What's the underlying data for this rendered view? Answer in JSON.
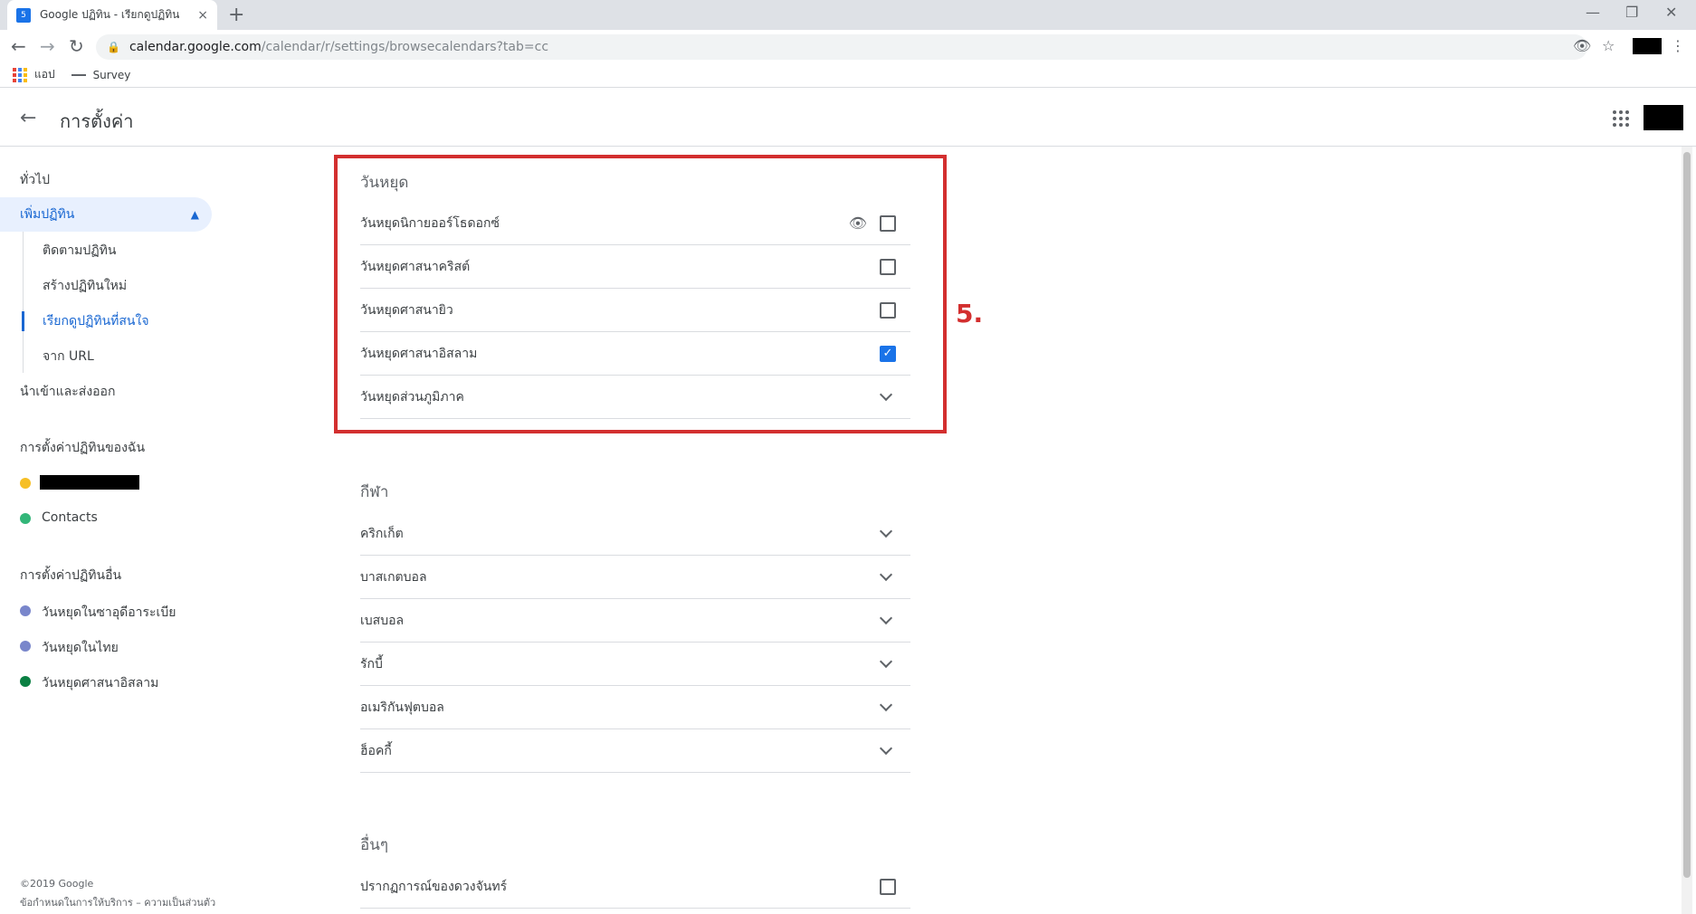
{
  "browser": {
    "tab_title": "Google ปฏิทิน - เรียกดูปฏิทิน",
    "tab_favicon_text": "5",
    "tab_close": "×",
    "new_tab": "+",
    "minimize": "—",
    "restore": "❐",
    "close": "✕",
    "url_host": "calendar.google.com",
    "url_path": "/calendar/r/settings/browsecalendars?tab=cc",
    "bookmarks": [
      {
        "label": "แอป"
      },
      {
        "label": "Survey"
      }
    ]
  },
  "app": {
    "title": "การตั้งค่า"
  },
  "sidebar": {
    "general": "ทั่วไป",
    "add_calendar": "เพิ่มปฏิทิน",
    "sub_items": [
      "ติดตามปฏิทิน",
      "สร้างปฏิทินใหม่",
      "เรียกดูปฏิทินที่สนใจ",
      "จาก URL"
    ],
    "import_export": "นำเข้าและส่งออก",
    "my_calendars_heading": "การตั้งค่าปฏิทินของฉัน",
    "my_calendars": [
      {
        "name": "",
        "color": "#f6bf26",
        "redacted": true
      },
      {
        "name": "Contacts",
        "color": "#33b679"
      }
    ],
    "other_calendars_heading": "การตั้งค่าปฏิทินอื่น",
    "other_calendars": [
      {
        "name": "วันหยุดในซาอุดีอาระเบีย",
        "color": "#7986cb"
      },
      {
        "name": "วันหยุดในไทย",
        "color": "#7986cb"
      },
      {
        "name": "วันหยุดศาสนาอิสลาม",
        "color": "#0b8043"
      }
    ],
    "footer_copyright": "©2019 Google",
    "footer_links": "ข้อกำหนดในการให้บริการ – ความเป็นส่วนตัว"
  },
  "main": {
    "holidays": {
      "title": "วันหยุด",
      "items": [
        {
          "label": "วันหยุดนิกายออร์โธดอกซ์",
          "checked": false,
          "has_eye": true
        },
        {
          "label": "วันหยุดศาสนาคริสต์",
          "checked": false
        },
        {
          "label": "วันหยุดศาสนายิว",
          "checked": false
        },
        {
          "label": "วันหยุดศาสนาอิสลาม",
          "checked": true
        },
        {
          "label": "วันหยุดส่วนภูมิภาค",
          "expandable": true
        }
      ]
    },
    "sports": {
      "title": "กีฬา",
      "items": [
        {
          "label": "คริกเก็ต"
        },
        {
          "label": "บาสเกตบอล"
        },
        {
          "label": "เบสบอล"
        },
        {
          "label": "รักบี้"
        },
        {
          "label": "อเมริกันฟุตบอล"
        },
        {
          "label": "ฮ็อคกี้"
        }
      ]
    },
    "other": {
      "title": "อื่นๆ",
      "items": [
        {
          "label": "ปรากฏการณ์ของดวงจันทร์",
          "checked": false
        }
      ]
    }
  },
  "annotation": {
    "label": "5."
  }
}
